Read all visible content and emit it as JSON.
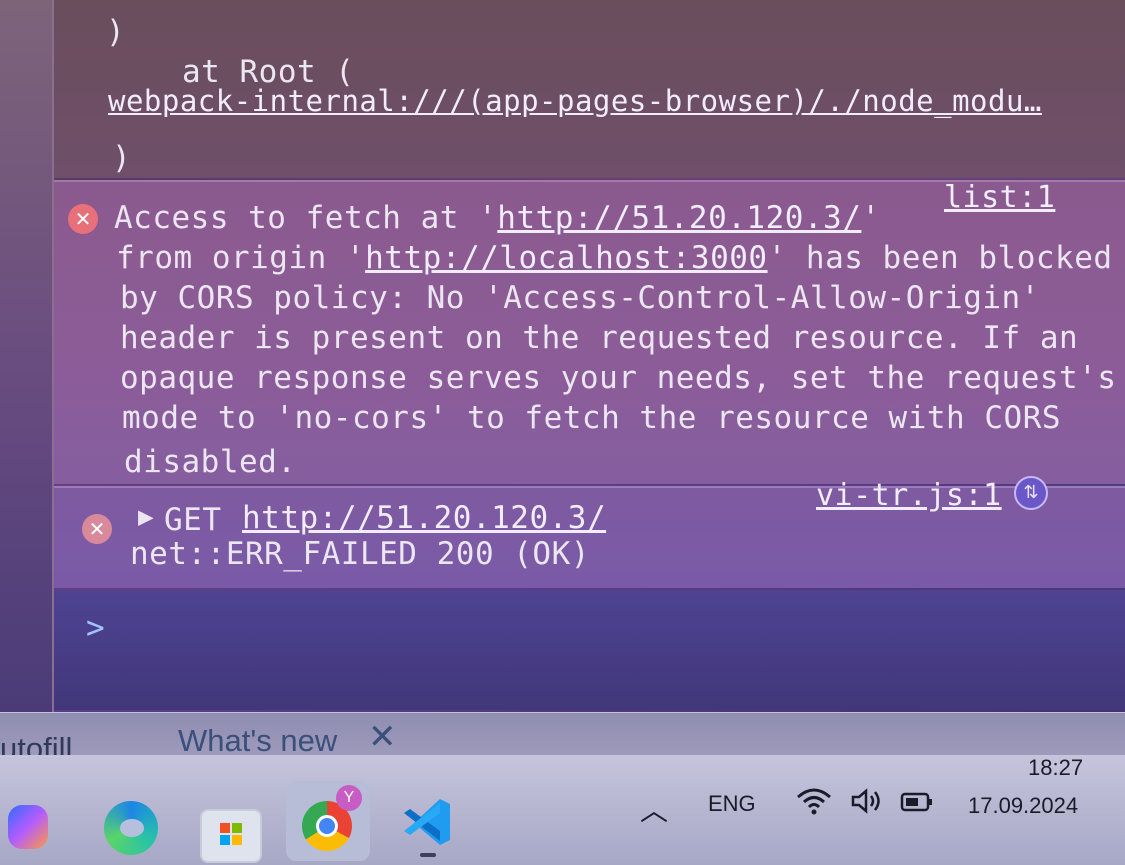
{
  "console": {
    "trace_close_paren_top": ")",
    "trace_at": "at Root (",
    "trace_link": "webpack-internal:///(app-pages-browser)/./node_modu…",
    "trace_close_paren_bottom": ")",
    "cors_error": {
      "lines": [
        {
          "pre": "Access to fetch at '",
          "link": "http://51.20.120.3/",
          "post": "'"
        },
        {
          "pre": "from origin '",
          "link": "http://localhost:3000",
          "post": "' has been blocked"
        },
        {
          "pre": "by CORS policy: No 'Access-Control-Allow-Origin'",
          "link": "",
          "post": ""
        },
        {
          "pre": "header is present on the requested resource. If an",
          "link": "",
          "post": ""
        },
        {
          "pre": "opaque response serves your needs, set the request's",
          "link": "",
          "post": ""
        },
        {
          "pre": "mode to 'no-cors' to fetch the resource with CORS",
          "link": "",
          "post": ""
        },
        {
          "pre": "disabled.",
          "link": "",
          "post": ""
        }
      ],
      "source": "list:1"
    },
    "get_error": {
      "method": "GET",
      "url": "http://51.20.120.3/",
      "status": "net::ERR_FAILED 200 (OK)",
      "source": "vi-tr.js:1"
    },
    "prompt_symbol": ">"
  },
  "devtools_tabs": {
    "autofill": "utofill",
    "whats_new": "What's new"
  },
  "taskbar": {
    "language": "ENG",
    "time": "18:27",
    "date": "17.09.2024"
  }
}
